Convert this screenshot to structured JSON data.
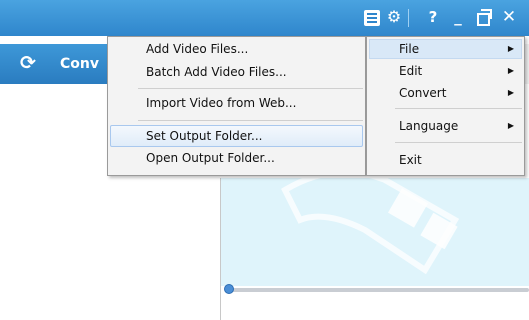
{
  "convert_bar": {
    "label": "Conv"
  },
  "title_bar": {
    "help": "?",
    "minimize": "_",
    "close": "✕"
  },
  "submenu": {
    "items": [
      {
        "label": "Add Video Files..."
      },
      {
        "label": "Batch Add Video Files..."
      },
      {
        "label": "Import Video from Web..."
      },
      {
        "label": "Set Output Folder..."
      },
      {
        "label": "Open Output Folder..."
      }
    ]
  },
  "main_menu": {
    "items": [
      {
        "label": "File",
        "arrow": "▶"
      },
      {
        "label": "Edit",
        "arrow": "▶"
      },
      {
        "label": "Convert",
        "arrow": "▶"
      },
      {
        "label": "Language",
        "arrow": "▶"
      },
      {
        "label": "Exit"
      }
    ]
  }
}
